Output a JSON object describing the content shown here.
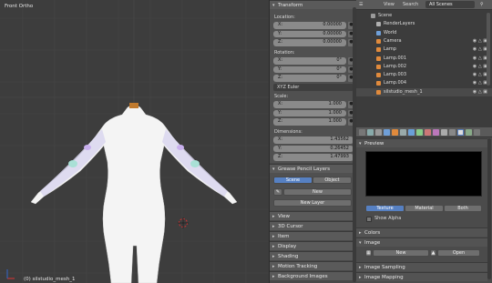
{
  "viewport": {
    "view_label": "Front Ortho",
    "object_label": "(0) silstudio_mesh_1"
  },
  "transform": {
    "header": "Transform",
    "location_label": "Location:",
    "location": [
      {
        "axis": "X:",
        "value": "0.00000"
      },
      {
        "axis": "Y:",
        "value": "0.00000"
      },
      {
        "axis": "Z:",
        "value": "0.00000"
      }
    ],
    "rotation_label": "Rotation:",
    "rotation": [
      {
        "axis": "X:",
        "value": "0°"
      },
      {
        "axis": "Y:",
        "value": "0°"
      },
      {
        "axis": "Z:",
        "value": "0°"
      }
    ],
    "rotation_mode": "XYZ Euler",
    "scale_label": "Scale:",
    "scale": [
      {
        "axis": "X:",
        "value": "1.000"
      },
      {
        "axis": "Y:",
        "value": "1.000"
      },
      {
        "axis": "Z:",
        "value": "1.000"
      }
    ],
    "dimensions_label": "Dimensions:",
    "dimensions": [
      {
        "axis": "X:",
        "value": "1.43562"
      },
      {
        "axis": "Y:",
        "value": "0.26452"
      },
      {
        "axis": "Z:",
        "value": "1.47993"
      }
    ]
  },
  "grease_pencil": {
    "header": "Grease Pencil Layers",
    "scene_tab": "Scene",
    "object_tab": "Object",
    "new_label": "New",
    "new_layer_label": "New Layer"
  },
  "collapsed_panels": [
    "View",
    "3D Cursor",
    "Item",
    "Display",
    "Shading",
    "Motion Tracking",
    "Background Images"
  ],
  "outliner": {
    "view_menu": "View",
    "search_menu": "Search",
    "scope": "All Scenes",
    "items": [
      {
        "label": "Scene",
        "icon": "scene-icon",
        "color": "#9a9a9a"
      },
      {
        "label": "RenderLayers",
        "icon": "render-layers-icon",
        "color": "#b0b0b0"
      },
      {
        "label": "World",
        "icon": "world-icon",
        "color": "#6f9fd8"
      },
      {
        "label": "Camera",
        "icon": "camera-icon",
        "color": "#e08a3c"
      },
      {
        "label": "Lamp",
        "icon": "lamp-icon",
        "color": "#e08a3c"
      },
      {
        "label": "Lamp.001",
        "icon": "lamp-icon",
        "color": "#e08a3c"
      },
      {
        "label": "Lamp.002",
        "icon": "lamp-icon",
        "color": "#e08a3c"
      },
      {
        "label": "Lamp.003",
        "icon": "lamp-icon",
        "color": "#e08a3c"
      },
      {
        "label": "Lamp.004",
        "icon": "lamp-icon",
        "color": "#e08a3c"
      },
      {
        "label": "silstudio_mesh_1",
        "icon": "mesh-icon",
        "color": "#e08a3c"
      }
    ]
  },
  "properties": {
    "preview_label": "Preview",
    "texture_tab": "Texture",
    "material_tab": "Material",
    "both_tab": "Both",
    "show_alpha_label": "Show Alpha",
    "colors_label": "Colors",
    "image_label": "Image",
    "image_new_label": "New",
    "image_open_label": "Open",
    "image_sampling_label": "Image Sampling",
    "image_mapping_label": "Image Mapping"
  },
  "colors": {
    "accent": "#5680c2",
    "viewport_bg": "#3d3d3d",
    "panel_bg": "#505050"
  }
}
